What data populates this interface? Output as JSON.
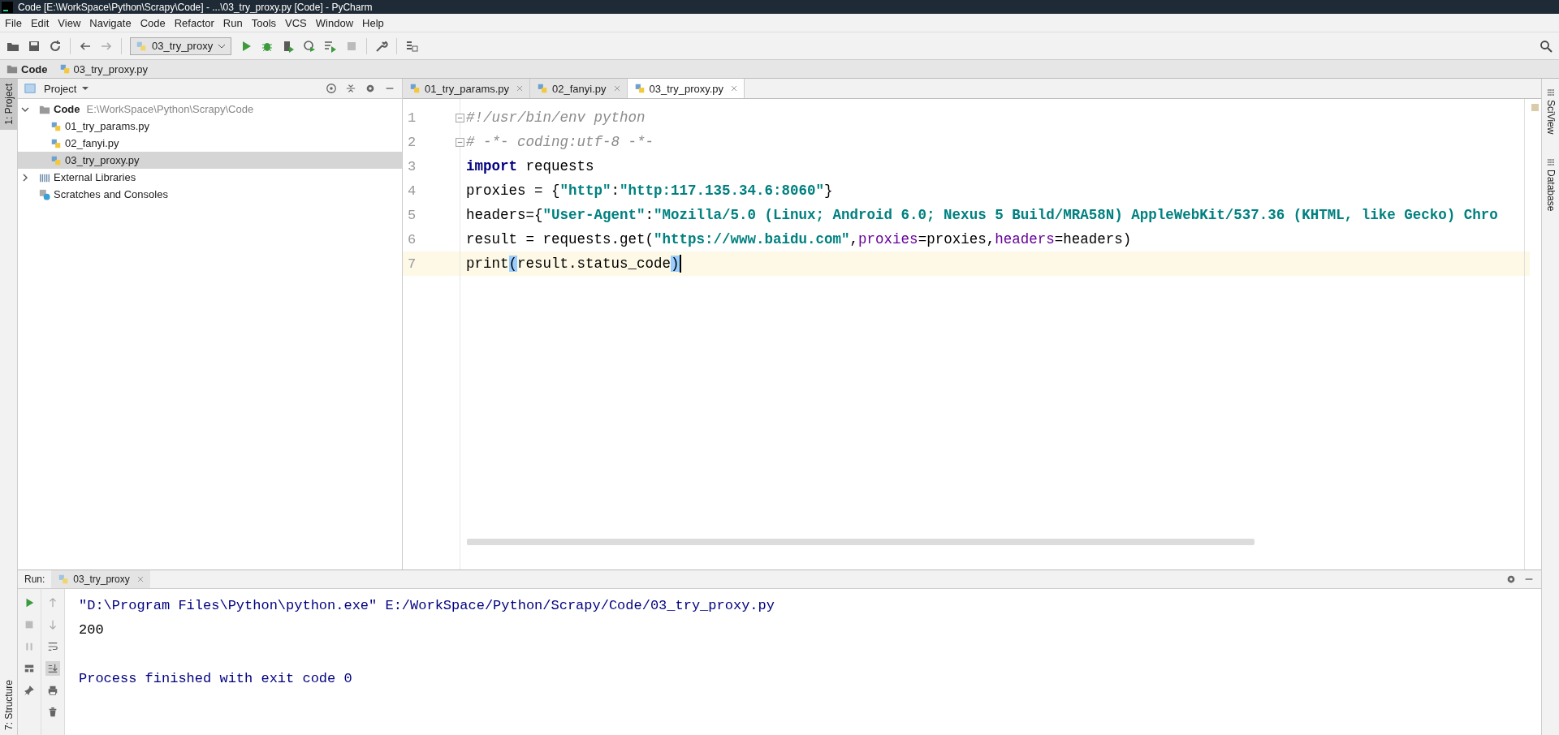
{
  "window": {
    "title": "Code [E:\\WorkSpace\\Python\\Scrapy\\Code] - ...\\03_try_proxy.py [Code] - PyCharm"
  },
  "menu": [
    "File",
    "Edit",
    "View",
    "Navigate",
    "Code",
    "Refactor",
    "Run",
    "Tools",
    "VCS",
    "Window",
    "Help"
  ],
  "toolbar": {
    "run_config": "03_try_proxy"
  },
  "breadcrumb": [
    {
      "label": "Code",
      "kind": "folder"
    },
    {
      "label": "03_try_proxy.py",
      "kind": "file"
    }
  ],
  "left_stripe": [
    {
      "label": "1: Project",
      "selected": true
    },
    {
      "label": "7: Structure",
      "selected": false
    }
  ],
  "right_stripe": [
    "SciView",
    "Database"
  ],
  "project": {
    "title": "Project",
    "tree": [
      {
        "label": "Code",
        "path": "E:\\WorkSpace\\Python\\Scrapy\\Code",
        "kind": "folder",
        "expanded": true,
        "selected": false,
        "children": [
          {
            "label": "01_try_params.py",
            "kind": "file",
            "selected": false
          },
          {
            "label": "02_fanyi.py",
            "kind": "file",
            "selected": false
          },
          {
            "label": "03_try_proxy.py",
            "kind": "file",
            "selected": true
          }
        ]
      },
      {
        "label": "External Libraries",
        "kind": "library",
        "expanded": false,
        "selected": false
      },
      {
        "label": "Scratches and Consoles",
        "kind": "scratch",
        "selected": false
      }
    ]
  },
  "editor_tabs": [
    {
      "label": "01_try_params.py",
      "selected": false
    },
    {
      "label": "02_fanyi.py",
      "selected": false
    },
    {
      "label": "03_try_proxy.py",
      "selected": true
    }
  ],
  "code": [
    {
      "number": "1",
      "fold": true,
      "current": false,
      "tokens": [
        {
          "text": "#!/usr/bin/env python",
          "kind": "comment"
        }
      ]
    },
    {
      "number": "2",
      "fold": true,
      "current": false,
      "tokens": [
        {
          "text": "# -*- coding:utf-8 -*-",
          "kind": "comment"
        }
      ]
    },
    {
      "number": "3",
      "fold": false,
      "current": false,
      "tokens": [
        {
          "text": "import",
          "kind": "keyword"
        },
        {
          "text": " requests",
          "kind": "plain"
        }
      ]
    },
    {
      "number": "4",
      "fold": false,
      "current": false,
      "tokens": [
        {
          "text": "proxies = {",
          "kind": "plain"
        },
        {
          "text": "\"http\"",
          "kind": "string"
        },
        {
          "text": ":",
          "kind": "plain"
        },
        {
          "text": "\"http:117.135.34.6:8060\"",
          "kind": "string"
        },
        {
          "text": "}",
          "kind": "plain"
        }
      ]
    },
    {
      "number": "5",
      "fold": false,
      "current": false,
      "tokens": [
        {
          "text": "headers={",
          "kind": "plain"
        },
        {
          "text": "\"User-Agent\"",
          "kind": "string"
        },
        {
          "text": ":",
          "kind": "plain"
        },
        {
          "text": "\"Mozilla/5.0 (Linux; Android 6.0; Nexus 5 Build/MRA58N) AppleWebKit/537.36 (KHTML, like Gecko) Chro",
          "kind": "string"
        }
      ]
    },
    {
      "number": "6",
      "fold": false,
      "current": false,
      "tokens": [
        {
          "text": "result = requests.get(",
          "kind": "plain"
        },
        {
          "text": "\"https://www.baidu.com\"",
          "kind": "string"
        },
        {
          "text": ",",
          "kind": "plain"
        },
        {
          "text": "proxies",
          "kind": "param"
        },
        {
          "text": "=proxies,",
          "kind": "plain"
        },
        {
          "text": "headers",
          "kind": "param"
        },
        {
          "text": "=headers)",
          "kind": "plain"
        }
      ]
    },
    {
      "number": "7",
      "fold": false,
      "current": true,
      "tokens": [
        {
          "text": "print",
          "kind": "plain"
        },
        {
          "text": "(",
          "kind": "brace"
        },
        {
          "text": "result.status_code",
          "kind": "plain"
        },
        {
          "text": ")",
          "kind": "brace"
        }
      ]
    }
  ],
  "run": {
    "label": "Run:",
    "tab": "03_try_proxy",
    "output": [
      {
        "text": "\"D:\\Program Files\\Python\\python.exe\" E:/WorkSpace/Python/Scrapy/Code/03_try_proxy.py",
        "kind": "command"
      },
      {
        "text": "200",
        "kind": "stdout"
      },
      {
        "text": "Process finished with exit code 0",
        "kind": "exit"
      }
    ]
  }
}
